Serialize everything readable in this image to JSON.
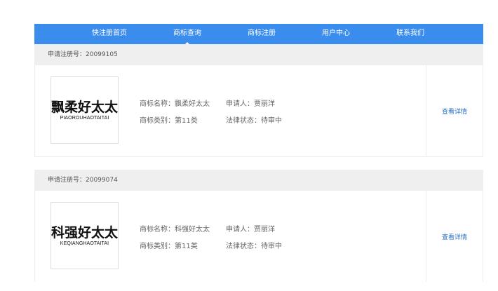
{
  "nav": {
    "items": [
      {
        "label": "快注册首页"
      },
      {
        "label": "商标查询"
      },
      {
        "label": "商标注册"
      },
      {
        "label": "用户中心"
      },
      {
        "label": "联系我们"
      }
    ],
    "active": "商标查询"
  },
  "results": [
    {
      "reg_no": "申请注册号：20099105",
      "logo_cn": "飘柔好太太",
      "logo_en": "PIAOROUHAOTAITAI",
      "name": "商标名称：飘柔好太太",
      "applicant": "申请人：贾丽洋",
      "category": "商标类别：第11类",
      "status": "法律状态：待审中",
      "details_label": "查看详情"
    },
    {
      "reg_no": "申请注册号：20099074",
      "logo_cn": "科强好太太",
      "logo_en": "KEQIANGHAOTAITAI",
      "name": "商标名称：科强好太太",
      "applicant": "申请人：贾丽洋",
      "category": "商标类别：第11类",
      "status": "法律状态：待审中",
      "details_label": "查看详情"
    }
  ],
  "colors": {
    "nav_bg": "#3b8ded",
    "header_bg": "#efefef",
    "link": "#2a6fc4"
  }
}
